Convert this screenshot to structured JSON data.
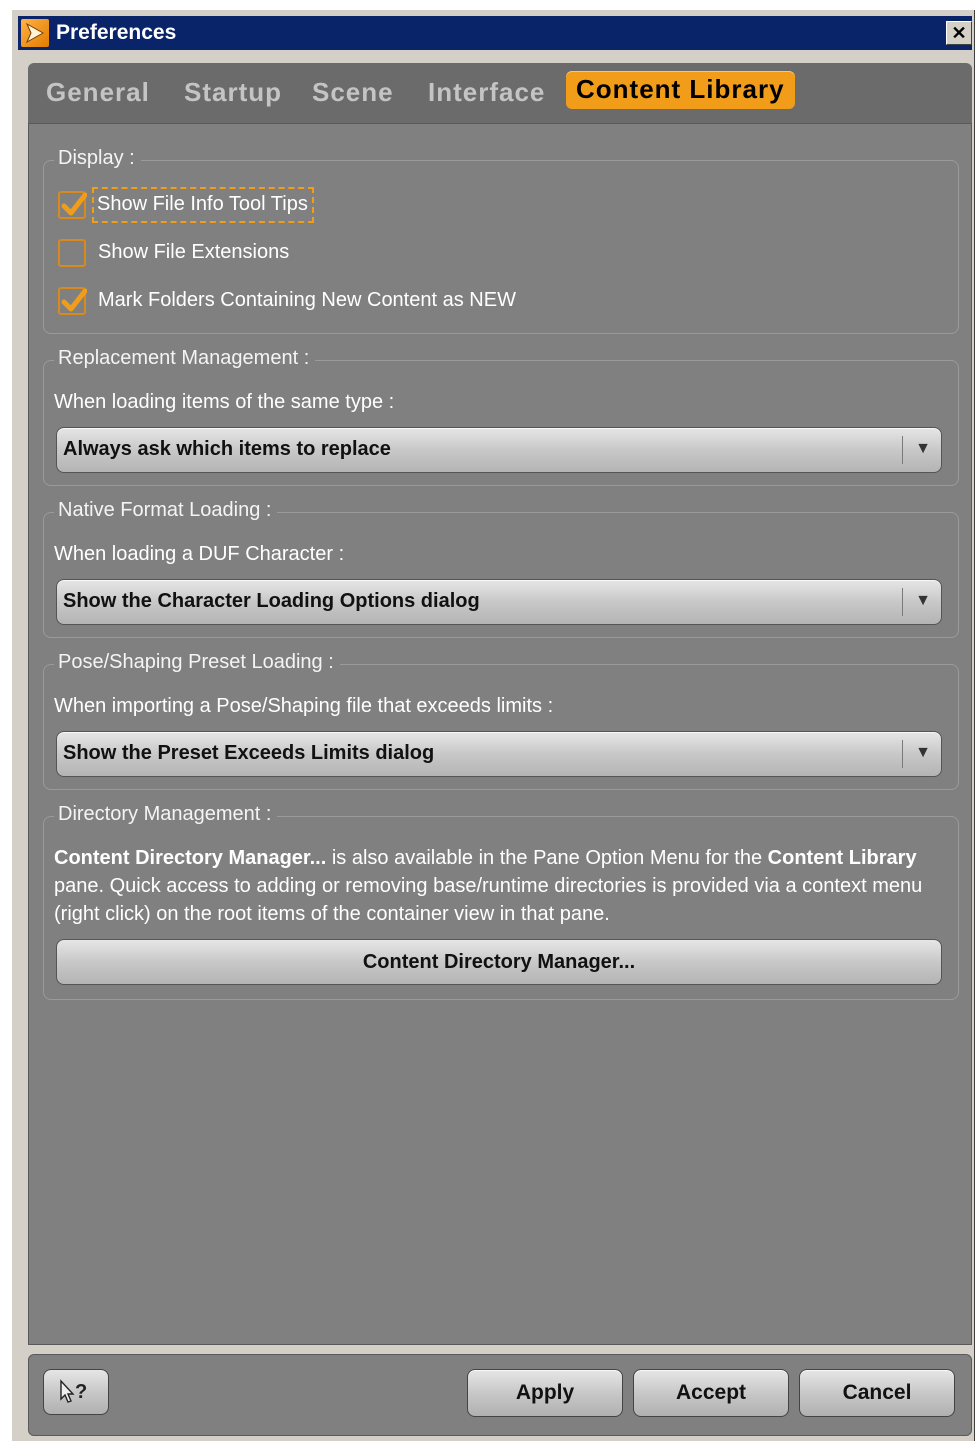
{
  "window": {
    "title": "Preferences",
    "close_glyph": "✕"
  },
  "tabs": [
    {
      "label": "General"
    },
    {
      "label": "Startup"
    },
    {
      "label": "Scene"
    },
    {
      "label": "Interface"
    },
    {
      "label": "Content Library",
      "active": true
    }
  ],
  "display": {
    "title": "Display :",
    "options": [
      {
        "label": "Show File Info Tool Tips",
        "checked": true
      },
      {
        "label": "Show File Extensions",
        "checked": false
      },
      {
        "label": "Mark Folders Containing New Content as NEW",
        "checked": true
      }
    ]
  },
  "replacement": {
    "title": "Replacement Management :",
    "prompt": "When loading items of the same type :",
    "selected": "Always ask which items to replace"
  },
  "native_format": {
    "title": "Native Format Loading :",
    "prompt": "When loading a DUF Character :",
    "selected": "Show the Character Loading Options dialog"
  },
  "pose_preset": {
    "title": "Pose/Shaping Preset Loading :",
    "prompt": "When importing a Pose/Shaping file that exceeds limits :",
    "selected": "Show the Preset Exceeds Limits dialog"
  },
  "directory": {
    "title": "Directory Management :",
    "desc_bold_1": "Content Directory Manager...",
    "desc_text_1": " is also available in the Pane Option Menu for the ",
    "desc_bold_2": "Content Library",
    "desc_text_2": " pane. Quick access to adding or removing base/runtime directories is provided via a context menu (right click) on the root items of the container view in that pane.",
    "button_label": "Content Directory Manager..."
  },
  "footer": {
    "help_icon": "whats-this-cursor-icon",
    "apply_label": "Apply",
    "accept_label": "Accept",
    "cancel_label": "Cancel"
  },
  "colors": {
    "accent": "#f29d1a",
    "title_bar": "#0a246a",
    "panel": "#808080"
  }
}
